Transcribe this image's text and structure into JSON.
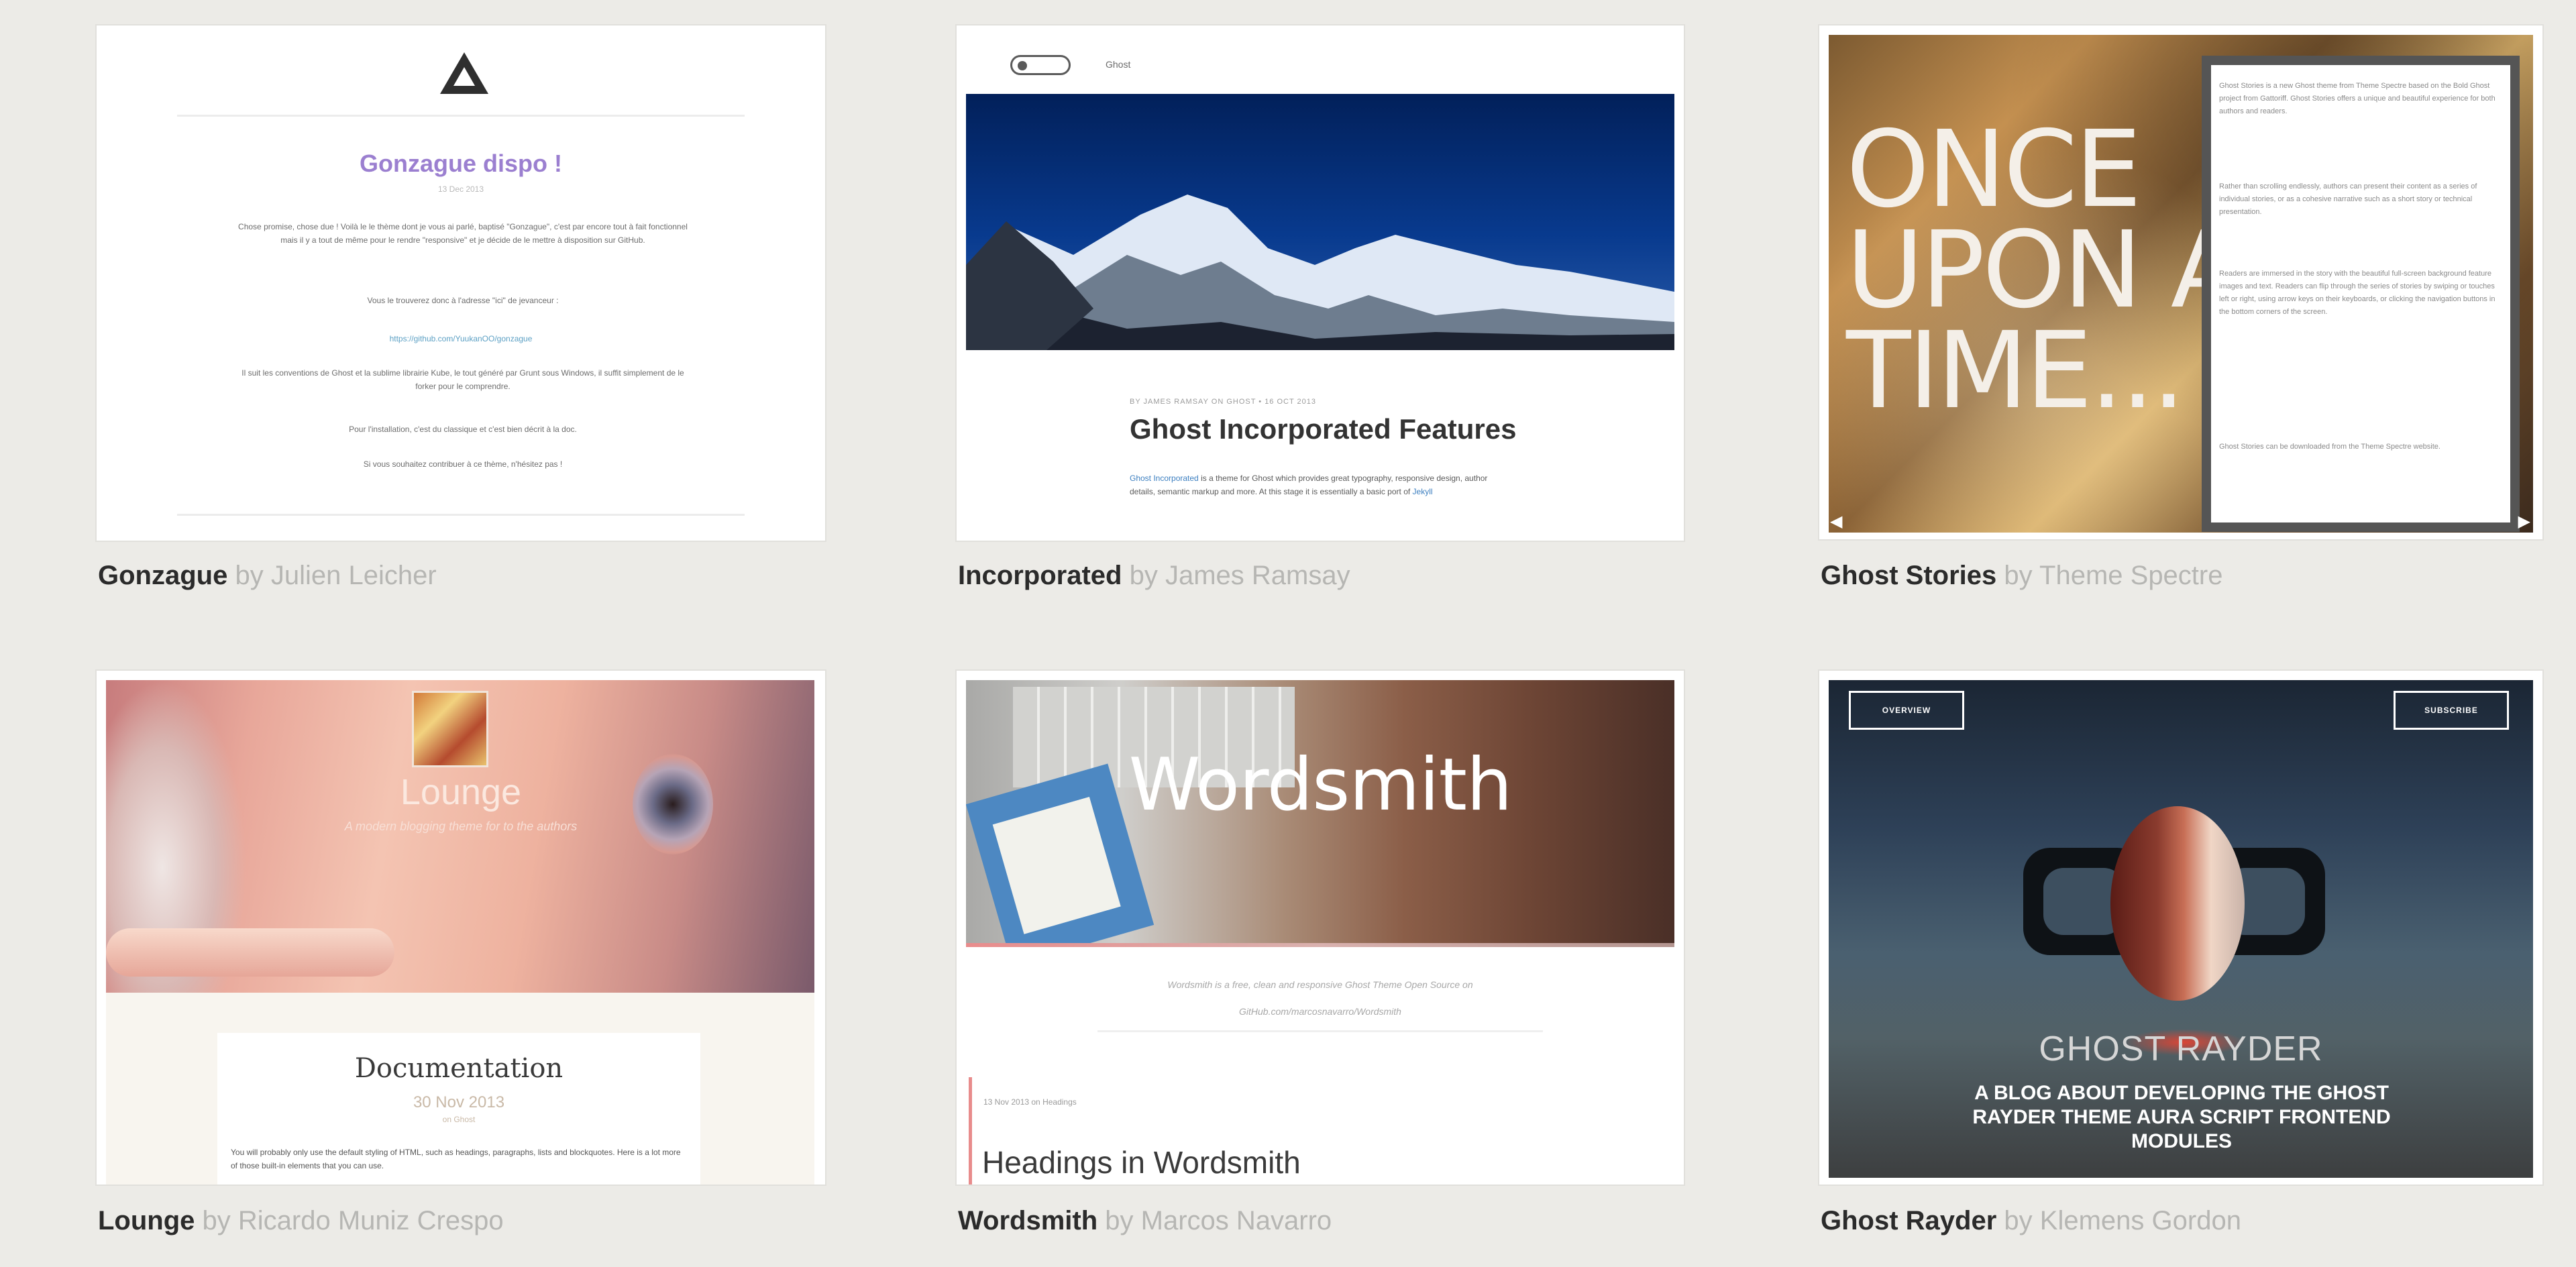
{
  "cards": {
    "gonzague": {
      "name": "Gonzague",
      "by": "by Julien Leicher",
      "preview": {
        "title": "Gonzague dispo !",
        "date": "13 Dec 2013",
        "p1": "Chose promise, chose due ! Voilà le le thème dont je vous ai parlé, baptisé \"Gonzague\", c'est par encore tout à fait fonctionnel mais il y a tout de même pour le rendre \"responsive\" et je décide de le mettre à disposition sur GitHub.",
        "p2": "Vous le trouverez donc à l'adresse \"ici\" de jevanceur :",
        "link": "https://github.com/YuukanOO/gonzague",
        "p3": "Il suit les conventions de Ghost et la sublime librairie Kube, le tout généré par Grunt sous Windows, il suffit simplement de le forker pour le comprendre.",
        "p4": "Pour l'installation, c'est du classique et c'est bien décrit à la doc.",
        "p5": "Si vous souhaitez contribuer à ce thème, n'hésitez pas !"
      }
    },
    "incorporated": {
      "name": "Incorporated",
      "by": "by James Ramsay",
      "preview": {
        "nav": "Ghost",
        "meta": "BY JAMES RAMSAY ON GHOST • 16 OCT 2013",
        "title": "Ghost Incorporated Features",
        "body_link": "Ghost Incorporated",
        "body": " is a theme for Ghost which provides great typography, responsive design, author details, semantic markup and more. At this stage it is essentially a basic port of",
        "body_link2": " Jekyll"
      }
    },
    "ghost_stories": {
      "name": "Ghost Stories",
      "by": "by Theme Spectre",
      "preview": {
        "line1": "ONCE",
        "line2": "UPON A",
        "line3": "TIME...",
        "p1": "Ghost Stories is a new Ghost theme from Theme Spectre based on the Bold Ghost project from Gattoriff. Ghost Stories offers a unique and beautiful experience for both authors and readers.",
        "p2": "Rather than scrolling endlessly, authors can present their content as a series of individual stories, or as a cohesive narrative such as a short story or technical presentation.",
        "p3": "Readers are immersed in the story with the beautiful full-screen background feature images and text. Readers can flip through the series of stories by swiping or touches left or right, using arrow keys on their keyboards, or clicking the navigation buttons in the bottom corners of the screen.",
        "p4": "Ghost Stories can be downloaded from the Theme Spectre website.",
        "arrow_left": "◀",
        "arrow_right": "▶"
      }
    },
    "lounge": {
      "name": "Lounge",
      "by": "by Ricardo Muniz Crespo",
      "preview": {
        "title": "Lounge",
        "subtitle": "A modern blogging theme for to the authors",
        "doc_title": "Documentation",
        "doc_date": "30 Nov 2013",
        "doc_sub": "on Ghost",
        "doc_p": "You will probably only use the default styling of HTML, such as headings, paragraphs, lists and blockquotes. Here is a lot more of those built-in elements that you can use."
      }
    },
    "wordsmith": {
      "name": "Wordsmith",
      "by": "by Marcos Navarro",
      "preview": {
        "title": "Wordsmith",
        "tagline": "Wordsmith is a free, clean and responsive Ghost Theme Open Source on",
        "url": "GitHub.com/marcosnavarro/Wordsmith",
        "meta": "13 Nov 2013 on Headings",
        "heading": "Headings in Wordsmith"
      }
    },
    "ghost_rayder": {
      "name": "Ghost Rayder",
      "by": "by Klemens Gordon",
      "preview": {
        "btn_left": "OVERVIEW",
        "btn_right": "SUBSCRIBE",
        "title": "GHOST RAYDER",
        "desc": "A BLOG ABOUT DEVELOPING THE GHOST RAYDER THEME AURA SCRIPT FRONTEND MODULES"
      }
    }
  }
}
